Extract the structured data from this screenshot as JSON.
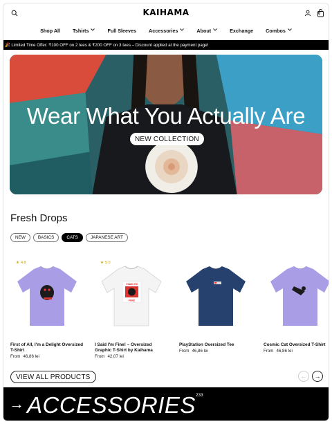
{
  "header": {
    "logo": "KAIHAMA",
    "cart_count": "0"
  },
  "nav": [
    {
      "label": "Shop All",
      "dropdown": false
    },
    {
      "label": "Tshirts",
      "dropdown": true
    },
    {
      "label": "Full Sleeves",
      "dropdown": false
    },
    {
      "label": "Accessories",
      "dropdown": true
    },
    {
      "label": "About",
      "dropdown": true
    },
    {
      "label": "Exchange",
      "dropdown": false
    },
    {
      "label": "Combos",
      "dropdown": true
    }
  ],
  "promo": {
    "text": "🎉 Limited Time Offer: ₹100 OFF on 2 tees & ₹200 OFF on 3 tees – Discount applied at the payment page!"
  },
  "hero": {
    "title": "Wear What You Actually Are",
    "button_label": "NEW COLLECTION"
  },
  "fresh_drops": {
    "title": "Fresh Drops",
    "filters": [
      {
        "label": "NEW",
        "active": false
      },
      {
        "label": "BASICS",
        "active": false
      },
      {
        "label": "CATS",
        "active": true
      },
      {
        "label": "JAPANESE ART",
        "active": false
      }
    ],
    "products": [
      {
        "name": "First of All, I'm a Delight Oversized T-Shirt",
        "price_prefix": "From",
        "price": "46,86 lei",
        "rating": "4.8",
        "tshirt_color": "#a99ee6"
      },
      {
        "name": "I Said I'm Fine! – Oversized Graphic T-Shirt by Kaihama",
        "price_prefix": "From",
        "price": "42,07 lei",
        "rating": "5.0",
        "tshirt_color": "#f4f4f4"
      },
      {
        "name": "PlayStation Oversized Tee",
        "price_prefix": "From",
        "price": "46,86 lei",
        "rating": "",
        "tshirt_color": "#26416d"
      },
      {
        "name": "Cosmic Cat Oversized T-Shirt",
        "price_prefix": "From",
        "price": "46,86 lei",
        "rating": "",
        "tshirt_color": "#a99ee6"
      }
    ],
    "view_all_label": "VIEW ALL PRODUCTS"
  },
  "accessories": {
    "arrow": "→",
    "title": "ACCESSORIES",
    "count": "233"
  }
}
